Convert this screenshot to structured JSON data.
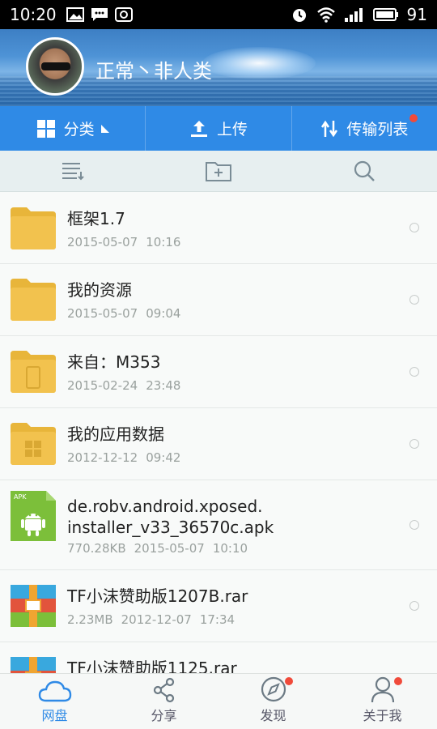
{
  "status_bar": {
    "time": "10:20",
    "battery": "91",
    "icons_left": [
      "image-icon",
      "message-icon",
      "app-icon"
    ],
    "icons_right": [
      "alarm-icon",
      "wifi-icon",
      "signal-icon",
      "battery-icon"
    ]
  },
  "profile": {
    "username": "正常丶非人类"
  },
  "actions": [
    {
      "label": "分类",
      "icon": "grid-icon"
    },
    {
      "label": "上传",
      "icon": "upload-icon"
    },
    {
      "label": "传输列表",
      "icon": "transfer-icon",
      "badge": true
    }
  ],
  "tools": [
    "sort-icon",
    "new-folder-icon",
    "search-icon"
  ],
  "files": [
    {
      "name": "框架1.7",
      "date": "2015-05-07",
      "time": "10:16",
      "type": "folder"
    },
    {
      "name": "我的资源",
      "date": "2015-05-07",
      "time": "09:04",
      "type": "folder"
    },
    {
      "name": "来自：M353",
      "date": "2015-02-24",
      "time": "23:48",
      "type": "folder-device"
    },
    {
      "name": "我的应用数据",
      "date": "2012-12-12",
      "time": "09:42",
      "type": "folder-apps"
    },
    {
      "name_line1": "de.robv.android.xposed.",
      "name_line2": "installer_v33_36570c.apk",
      "size": "770.28KB",
      "date": "2015-05-07",
      "time": "10:10",
      "type": "apk",
      "apk_tag": "APK"
    },
    {
      "name": "TF小沫赞助版1207B.rar",
      "size": "2.23MB",
      "date": "2012-12-07",
      "time": "17:34",
      "type": "rar"
    },
    {
      "name": "TF小沫赞助版1125.rar",
      "type": "rar"
    }
  ],
  "bottom_nav": [
    {
      "label": "网盘",
      "icon": "cloud-icon",
      "active": true
    },
    {
      "label": "分享",
      "icon": "share-icon"
    },
    {
      "label": "发现",
      "icon": "compass-icon",
      "badge": true
    },
    {
      "label": "关于我",
      "icon": "person-icon",
      "badge": true
    }
  ],
  "colors": {
    "accent": "#2f8ae6",
    "badge": "#f04a3a",
    "folder": "#f2c24e"
  }
}
